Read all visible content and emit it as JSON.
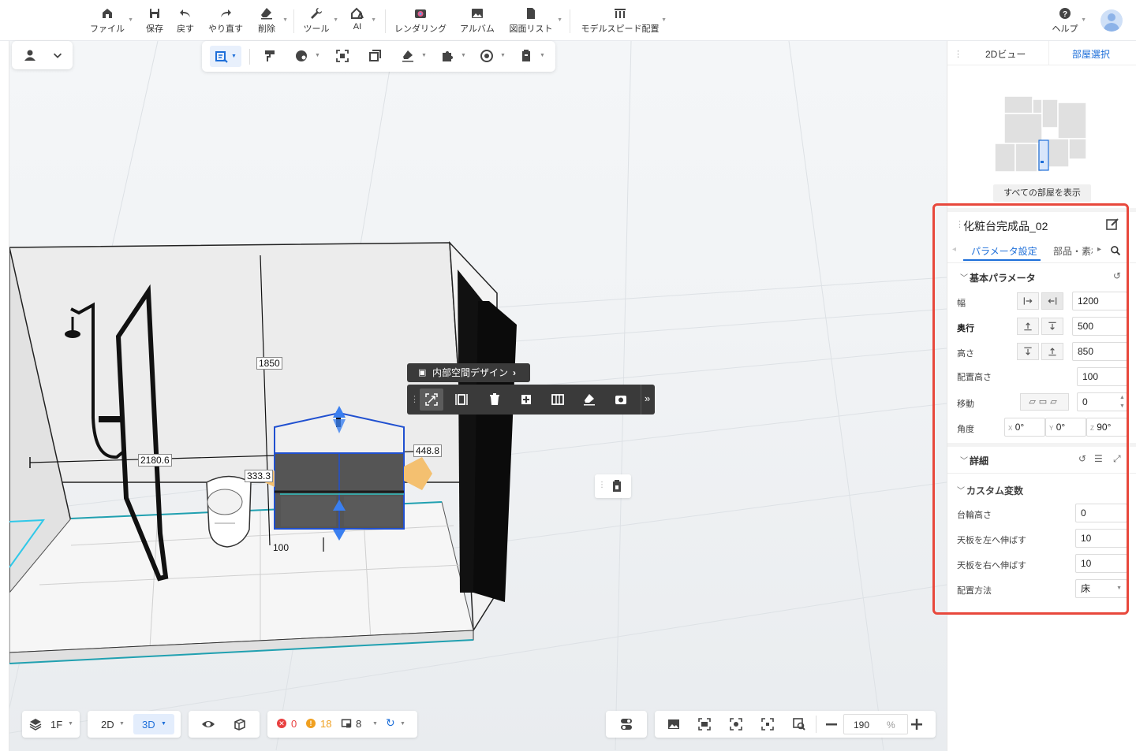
{
  "toolbar": {
    "file": "ファイル",
    "save": "保存",
    "undo": "戻す",
    "redo": "やり直す",
    "delete": "削除",
    "tools": "ツール",
    "ai": "AI",
    "render": "レンダリング",
    "album": "アルバム",
    "drawing_list": "図面リスト",
    "model_speed": "モデルスピード配置",
    "help": "ヘルプ"
  },
  "context": {
    "interior_design": "内部空間デザイン"
  },
  "dims": {
    "d1850": "1850",
    "d2180": "2180.6",
    "d333": "333.3",
    "d448": "448.8",
    "d100": "100"
  },
  "right_panel": {
    "tabs": [
      "2Dビュー",
      "部屋選択"
    ],
    "show_all_rooms": "すべての部屋を表示",
    "object_name": "化粧台完成品_02",
    "subtabs": [
      "パラメータ設定",
      "部品・素材"
    ],
    "basic_params": "基本パラメータ",
    "params": [
      {
        "label": "幅",
        "value": "1200"
      },
      {
        "label": "奥行",
        "value": "500"
      },
      {
        "label": "高さ",
        "value": "850"
      },
      {
        "label": "配置高さ",
        "value": "100"
      },
      {
        "label": "移動",
        "value": "0"
      }
    ],
    "angle": {
      "label": "角度",
      "x_label": "X",
      "x": "0°",
      "y_label": "Y",
      "y": "0°",
      "z_label": "Z",
      "z": "90°"
    },
    "details": "詳細",
    "custom_vars": "カスタム変数",
    "custom": [
      {
        "label": "台輪高さ",
        "value": "0"
      },
      {
        "label": "天板を左へ伸ばす",
        "value": "10"
      },
      {
        "label": "天板を右へ伸ばす",
        "value": "10"
      },
      {
        "label": "配置方法",
        "value": "床"
      }
    ]
  },
  "bottom": {
    "floor": "1F",
    "mode2d": "2D",
    "mode3d": "3D",
    "errors": "0",
    "warnings": "18",
    "items": "8",
    "zoom": "190",
    "zoom_unit": "%"
  },
  "colors": {
    "accent": "#1e6fd9",
    "highlight": "#e8483c",
    "error": "#e84040",
    "warning": "#f0a020"
  }
}
